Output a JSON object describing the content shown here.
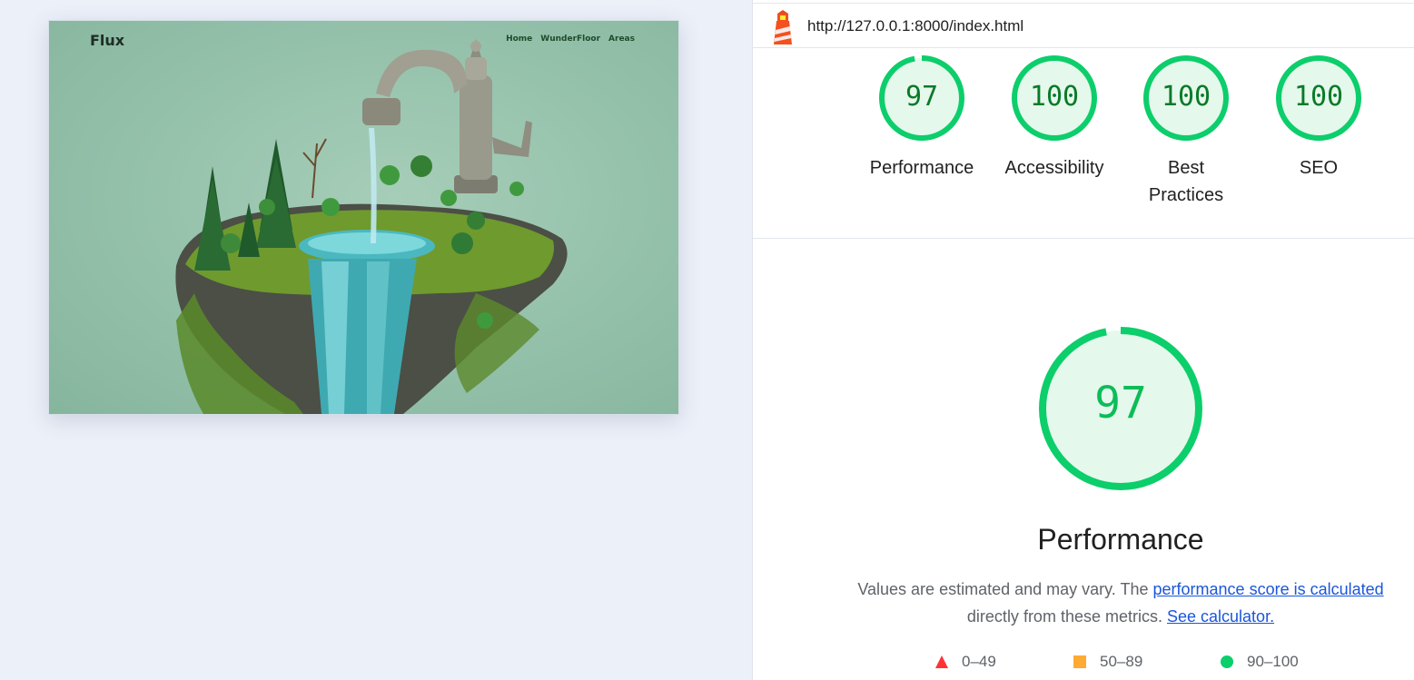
{
  "preview": {
    "logo": "Flux",
    "nav": [
      "Home",
      "WunderFloor",
      "Areas"
    ]
  },
  "report": {
    "url": "http://127.0.0.1:8000/index.html",
    "gauges": [
      {
        "label": "Performance",
        "score": "97",
        "value": 97
      },
      {
        "label": "Accessibility",
        "score": "100",
        "value": 100
      },
      {
        "label": "Best Practices",
        "score": "100",
        "value": 100
      },
      {
        "label": "SEO",
        "score": "100",
        "value": 100
      }
    ],
    "main_gauge": {
      "score": "97",
      "value": 97,
      "title": "Performance"
    },
    "description": {
      "text1": "Values are estimated and may vary. The ",
      "link1": "performance score is calculated",
      "text2": "directly from these metrics.",
      "link2": "See calculator."
    },
    "legend": [
      {
        "range": "0–49",
        "shape": "triangle",
        "color": "#ff3333"
      },
      {
        "range": "50–89",
        "shape": "square",
        "color": "#ffaa33"
      },
      {
        "range": "90–100",
        "shape": "circle",
        "color": "#0cce6b"
      }
    ]
  },
  "colors": {
    "pass": "#0cce6b",
    "pass_fill": "#e5f8ec",
    "pass_text": "#0a7a28",
    "link": "#1a56db"
  }
}
